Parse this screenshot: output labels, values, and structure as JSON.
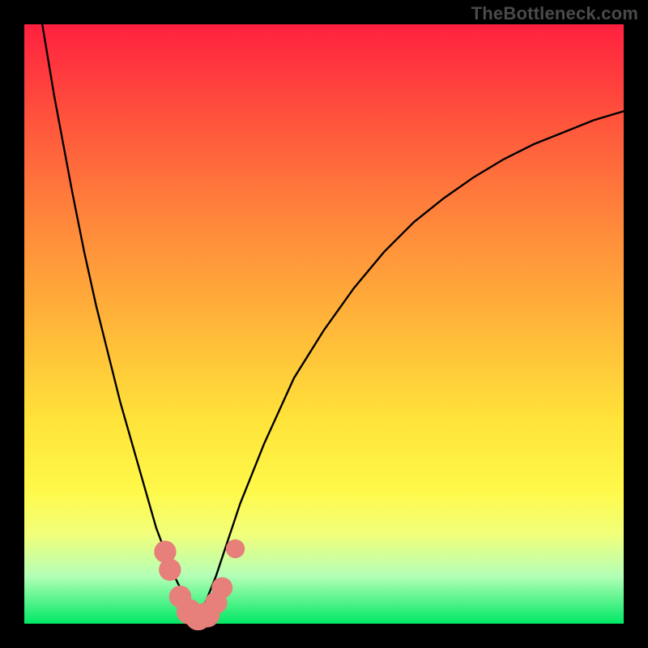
{
  "watermark": "TheBottleneck.com",
  "colors": {
    "frame": "#000000",
    "gradient_stops": [
      {
        "pct": 0,
        "hex": "#ff203f"
      },
      {
        "pct": 18,
        "hex": "#ff5a3c"
      },
      {
        "pct": 34,
        "hex": "#ff8a3b"
      },
      {
        "pct": 50,
        "hex": "#ffb639"
      },
      {
        "pct": 66,
        "hex": "#ffe33a"
      },
      {
        "pct": 78,
        "hex": "#fff94a"
      },
      {
        "pct": 85,
        "hex": "#f2ff7a"
      },
      {
        "pct": 92,
        "hex": "#b4ffb6"
      },
      {
        "pct": 100,
        "hex": "#00e865"
      }
    ],
    "curve": "#000000",
    "marker": "#e77f7a"
  },
  "chart_data": {
    "type": "line",
    "title": "",
    "xlabel": "",
    "ylabel": "",
    "xlim": [
      0,
      100
    ],
    "ylim": [
      0,
      100
    ],
    "note": "y is bottleneck percentage; 0 is bottom (green), 100 is top (red). Values estimated from pixels.",
    "series": [
      {
        "name": "left-curve",
        "x": [
          3,
          5,
          8,
          10,
          12,
          14,
          16,
          18,
          20,
          22,
          23.5,
          25,
          26.5,
          28,
          29
        ],
        "y": [
          100,
          88,
          72,
          62,
          53,
          45,
          37,
          30,
          23,
          16,
          12,
          8,
          5,
          2.5,
          1
        ]
      },
      {
        "name": "right-curve",
        "x": [
          29,
          30,
          32,
          34,
          36,
          40,
          45,
          50,
          55,
          60,
          65,
          70,
          75,
          80,
          85,
          90,
          95,
          100
        ],
        "y": [
          1,
          3,
          8,
          14,
          20,
          30,
          41,
          49,
          56,
          62,
          67,
          71,
          74.5,
          77.5,
          80,
          82,
          84,
          85.5
        ]
      }
    ],
    "markers": [
      {
        "x": 23.5,
        "y": 12,
        "r": 1.3
      },
      {
        "x": 24.3,
        "y": 9,
        "r": 1.3
      },
      {
        "x": 26.0,
        "y": 4.5,
        "r": 1.3
      },
      {
        "x": 27.5,
        "y": 2.0,
        "r": 1.6
      },
      {
        "x": 29.0,
        "y": 1.0,
        "r": 1.6
      },
      {
        "x": 30.5,
        "y": 1.5,
        "r": 1.6
      },
      {
        "x": 32.0,
        "y": 3.5,
        "r": 1.3
      },
      {
        "x": 33.0,
        "y": 6.0,
        "r": 1.2
      },
      {
        "x": 35.2,
        "y": 12.5,
        "r": 1.0
      }
    ]
  }
}
